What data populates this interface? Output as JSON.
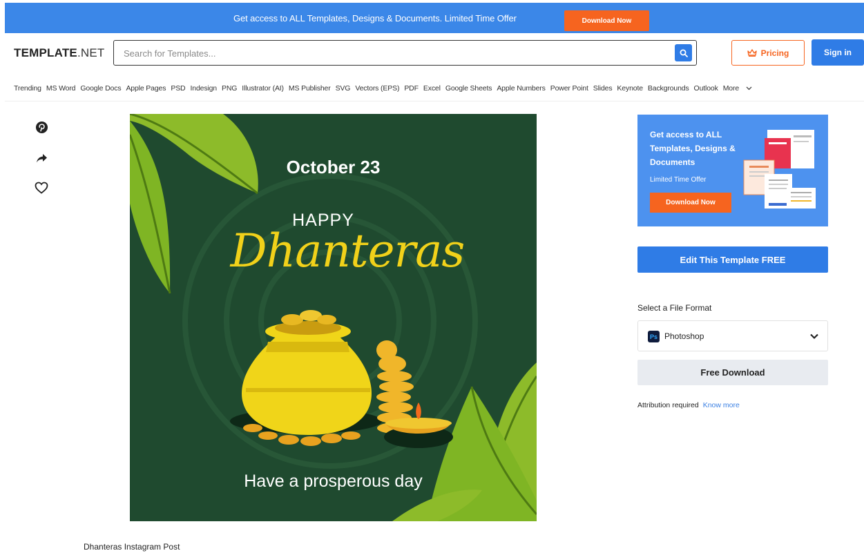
{
  "promo": {
    "text": "Get access to ALL Templates, Designs & Documents. Limited Time Offer",
    "button": "Download Now"
  },
  "header": {
    "logo_bold": "TEMPLATE",
    "logo_light": ".NET",
    "search_placeholder": "Search for Templates...",
    "pricing": "Pricing",
    "signin": "Sign in"
  },
  "nav": {
    "items": [
      "Trending",
      "MS Word",
      "Google Docs",
      "Apple Pages",
      "PSD",
      "Indesign",
      "PNG",
      "Illustrator (AI)",
      "MS Publisher",
      "SVG",
      "Vectors (EPS)",
      "PDF",
      "Excel",
      "Google Sheets",
      "Apple Numbers",
      "Power Point",
      "Slides",
      "Keynote",
      "Backgrounds",
      "Outlook"
    ],
    "more": "More"
  },
  "social": {
    "icons": [
      "pinterest-icon",
      "share-icon",
      "heart-icon"
    ]
  },
  "preview": {
    "date": "October 23",
    "happy": "HAPPY",
    "title": "Dhanteras",
    "tagline": "Have a prosperous day",
    "caption": "Dhanteras Instagram Post"
  },
  "ad": {
    "title": "Get access to ALL Templates, Designs & Documents",
    "subtitle": "Limited Time Offer",
    "button": "Download Now"
  },
  "actions": {
    "edit": "Edit This Template FREE",
    "format_label": "Select a File Format",
    "format_badge": "Ps",
    "format_value": "Photoshop",
    "download": "Free Download",
    "attribution": "Attribution required",
    "know_more": "Know more"
  },
  "colors": {
    "primary": "#2f7ce6",
    "promo_bg": "#3b87e8",
    "accent": "#f6641f",
    "preview_bg": "#1f4a2f",
    "gold": "#f1d11a"
  }
}
